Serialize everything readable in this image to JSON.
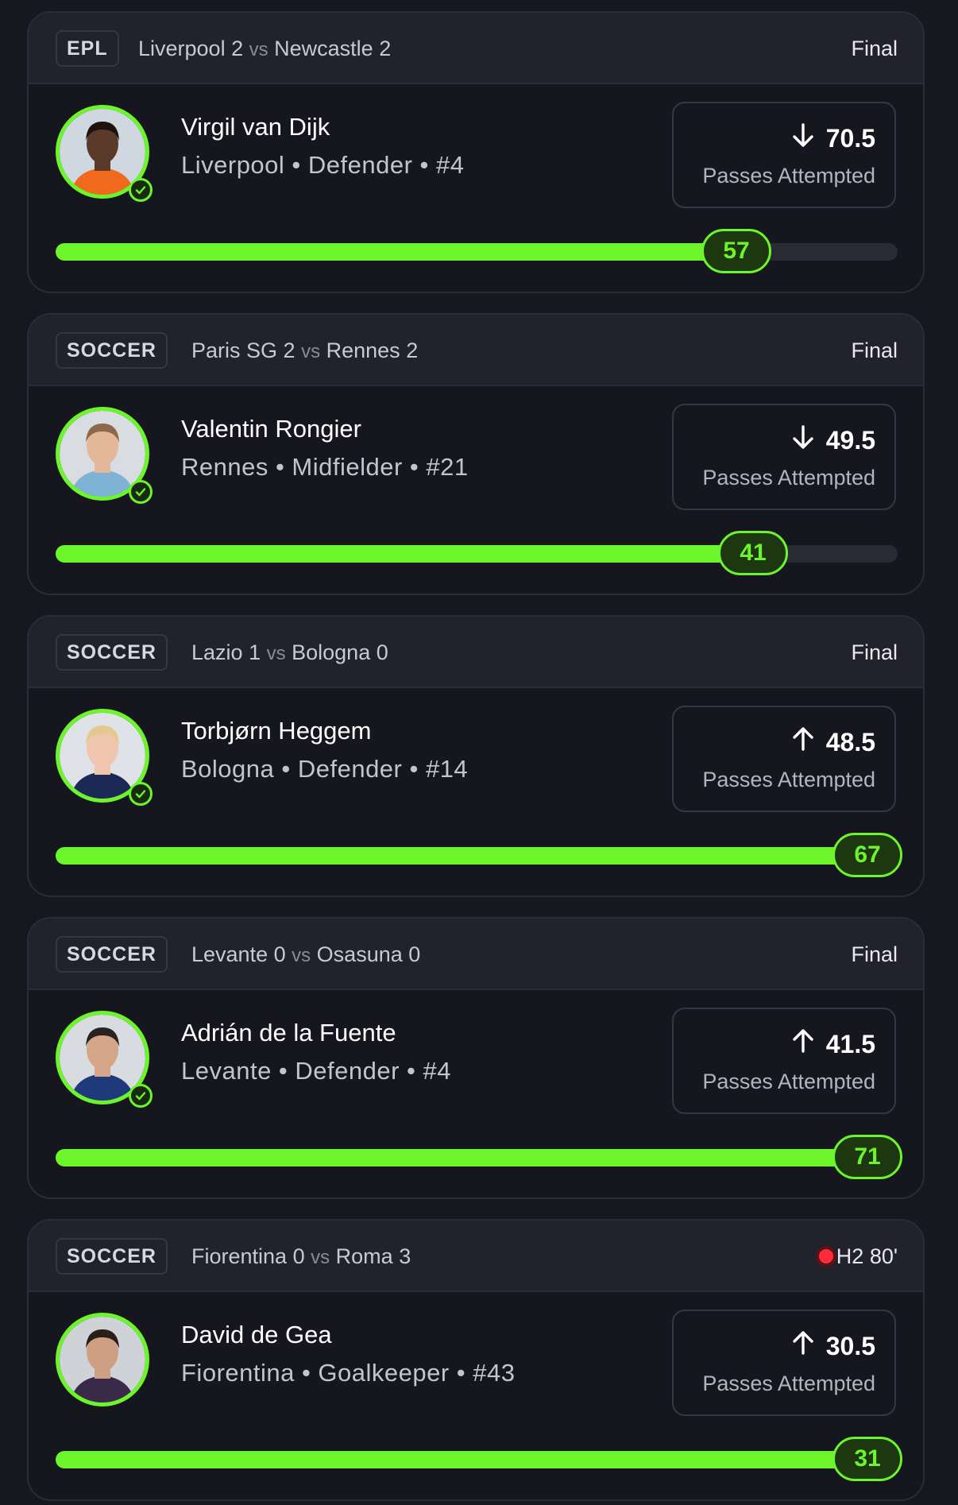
{
  "cards": [
    {
      "league": "EPL",
      "home_team": "Liverpool",
      "home_score": "2",
      "vs": "vs",
      "away_team": "Newcastle",
      "away_score": "2",
      "status": "Final",
      "live": false,
      "player": "Virgil van Dijk",
      "meta": "Liverpool • Defender • #4",
      "direction": "down",
      "line": "70.5",
      "stat_label": "Passes Attempted",
      "actual": "57",
      "progress": 0.8085,
      "avatar_colors": {
        "bg": "#cfd8e0",
        "skin": "#5a3a28",
        "shirt": "#f06a1e",
        "hair": "#1d1410"
      },
      "verified": true
    },
    {
      "league": "SOCCER",
      "home_team": "Paris SG",
      "home_score": "2",
      "vs": "vs",
      "away_team": "Rennes",
      "away_score": "2",
      "status": "Final",
      "live": false,
      "player": "Valentin Rongier",
      "meta": "Rennes • Midfielder • #21",
      "direction": "down",
      "line": "49.5",
      "stat_label": "Passes Attempted",
      "actual": "41",
      "progress": 0.8283,
      "avatar_colors": {
        "bg": "#d9dde2",
        "skin": "#e2b79a",
        "shirt": "#7fb3d6",
        "hair": "#8a6a4a"
      },
      "verified": true
    },
    {
      "league": "SOCCER",
      "home_team": "Lazio",
      "home_score": "1",
      "vs": "vs",
      "away_team": "Bologna",
      "away_score": "0",
      "status": "Final",
      "live": false,
      "player": "Torbjørn Heggem",
      "meta": "Bologna • Defender • #14",
      "direction": "up",
      "line": "48.5",
      "stat_label": "Passes Attempted",
      "actual": "67",
      "progress": 1.0,
      "avatar_colors": {
        "bg": "#dfe2e6",
        "skin": "#efc6ad",
        "shirt": "#1b2a55",
        "hair": "#e4c98e"
      },
      "verified": true
    },
    {
      "league": "SOCCER",
      "home_team": "Levante",
      "home_score": "0",
      "vs": "vs",
      "away_team": "Osasuna",
      "away_score": "0",
      "status": "Final",
      "live": false,
      "player": "Adrián de la Fuente",
      "meta": "Levante • Defender • #4",
      "direction": "up",
      "line": "41.5",
      "stat_label": "Passes Attempted",
      "actual": "71",
      "progress": 1.0,
      "avatar_colors": {
        "bg": "#d8dce0",
        "skin": "#d5a58a",
        "shirt": "#1f3a7a",
        "hair": "#2a2220"
      },
      "verified": true
    },
    {
      "league": "SOCCER",
      "home_team": "Fiorentina",
      "home_score": "0",
      "vs": "vs",
      "away_team": "Roma",
      "away_score": "3",
      "status": "H2 80'",
      "live": true,
      "player": "David de Gea",
      "meta": "Fiorentina • Goalkeeper • #43",
      "direction": "up",
      "line": "30.5",
      "stat_label": "Passes Attempted",
      "actual": "31",
      "progress": 1.0,
      "avatar_colors": {
        "bg": "#cfd3d8",
        "skin": "#cf9f84",
        "shirt": "#3a2a4a",
        "hair": "#2a1e18"
      },
      "verified": false
    }
  ]
}
